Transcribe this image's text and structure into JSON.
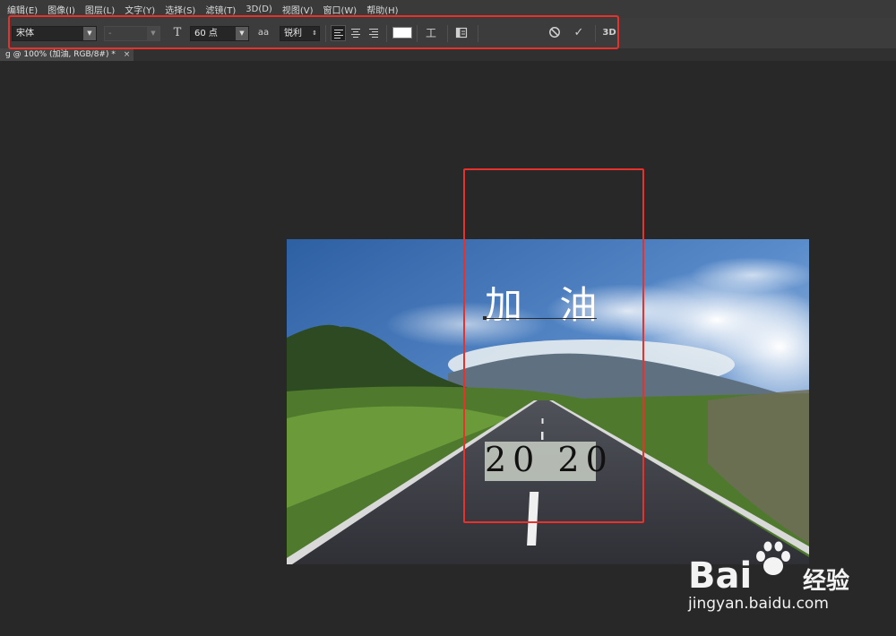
{
  "menu": [
    "编辑(E)",
    "图像(I)",
    "图层(L)",
    "文字(Y)",
    "选择(S)",
    "滤镜(T)",
    "3D(D)",
    "视图(V)",
    "窗口(W)",
    "帮助(H)"
  ],
  "options": {
    "font_family": "宋体",
    "font_style": "-",
    "font_size": "60 点",
    "font_size_icon_label": "T",
    "antialias_icon_label": "aa",
    "antialias": "锐利",
    "warp_icon_label": "工",
    "cancel_glyph": "⃠",
    "commit_glyph": "✓",
    "three_d_label": "3D",
    "text_color": "#ffffff",
    "align_selected": "left"
  },
  "document_tab": {
    "title": "g @ 100% (加油, RGB/8#) *",
    "close": "×"
  },
  "canvas": {
    "text_main": "加 油",
    "text_year": "20 20"
  },
  "watermark": {
    "brand": "Bai",
    "brand_suffix": "经验",
    "url": "jingyan.baidu.com"
  },
  "highlight_color": "#e8312a"
}
